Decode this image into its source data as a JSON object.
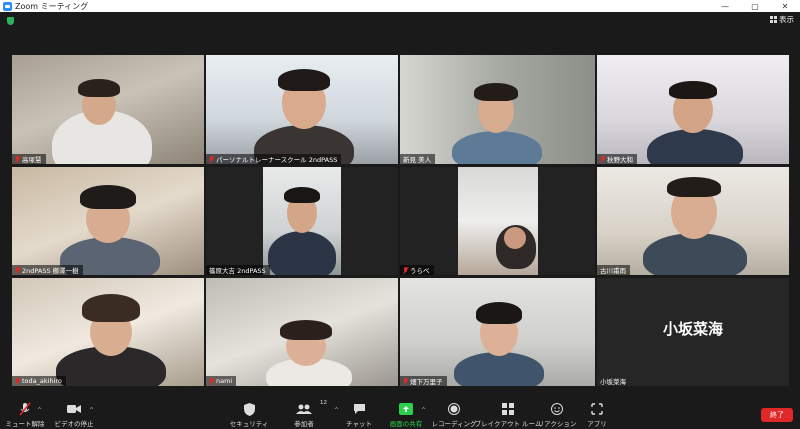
{
  "window": {
    "title": "Zoom ミーティング",
    "controls": [
      "—",
      "▢",
      "✕"
    ],
    "view_label": "表示"
  },
  "participants": [
    {
      "name": "高塚慧",
      "muted": true,
      "active": false
    },
    {
      "name": "パーソナルトレーナースクール 2ndPASS",
      "muted": true,
      "active": false
    },
    {
      "name": "新見 美人",
      "muted": false,
      "active": true
    },
    {
      "name": "秋野大和",
      "muted": true,
      "active": false
    },
    {
      "name": "2ndPASS 櫛澤一樹",
      "muted": true,
      "active": false
    },
    {
      "name": "篠原大吉 2ndPASS",
      "muted": false,
      "active": false
    },
    {
      "name": "うらべ",
      "muted": true,
      "active": false
    },
    {
      "name": "古川甫雨",
      "muted": false,
      "active": false
    },
    {
      "name": "toda_akihiro",
      "muted": true,
      "active": false
    },
    {
      "name": "nami",
      "muted": true,
      "active": false
    },
    {
      "name": "畑下万里子",
      "muted": true,
      "active": false
    },
    {
      "name": "小坂菜海",
      "muted": false,
      "active": false,
      "big_name": "小坂菜海"
    }
  ],
  "toolbar": {
    "mute": "ミュート解除",
    "video": "ビデオの停止",
    "security": "セキュリティ",
    "participants": "参加者",
    "participants_count": "12",
    "chat": "チャット",
    "share": "画面の共有",
    "record": "レコーディング",
    "breakout": "ブレイクアウト ルーム",
    "reactions": "リアクション",
    "apps": "アプリ",
    "end": "終了"
  },
  "colors": {
    "accent_green": "#b9e14b",
    "end_red": "#e02828",
    "share_green": "#2bd14a"
  }
}
